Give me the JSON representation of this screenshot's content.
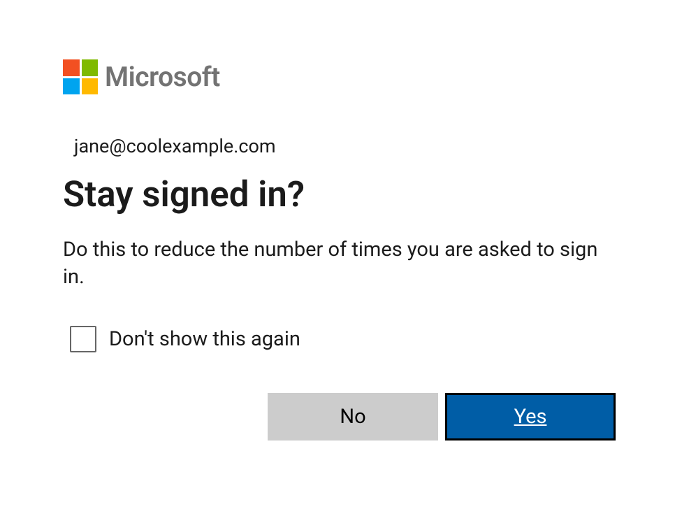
{
  "brand": {
    "name": "Microsoft"
  },
  "identity": {
    "email": "jane@coolexample.com"
  },
  "dialog": {
    "heading": "Stay signed in?",
    "description": "Do this to reduce the number of times you are asked to sign in.",
    "checkbox_label": "Don't show this again"
  },
  "buttons": {
    "no": "No",
    "yes": "Yes"
  }
}
